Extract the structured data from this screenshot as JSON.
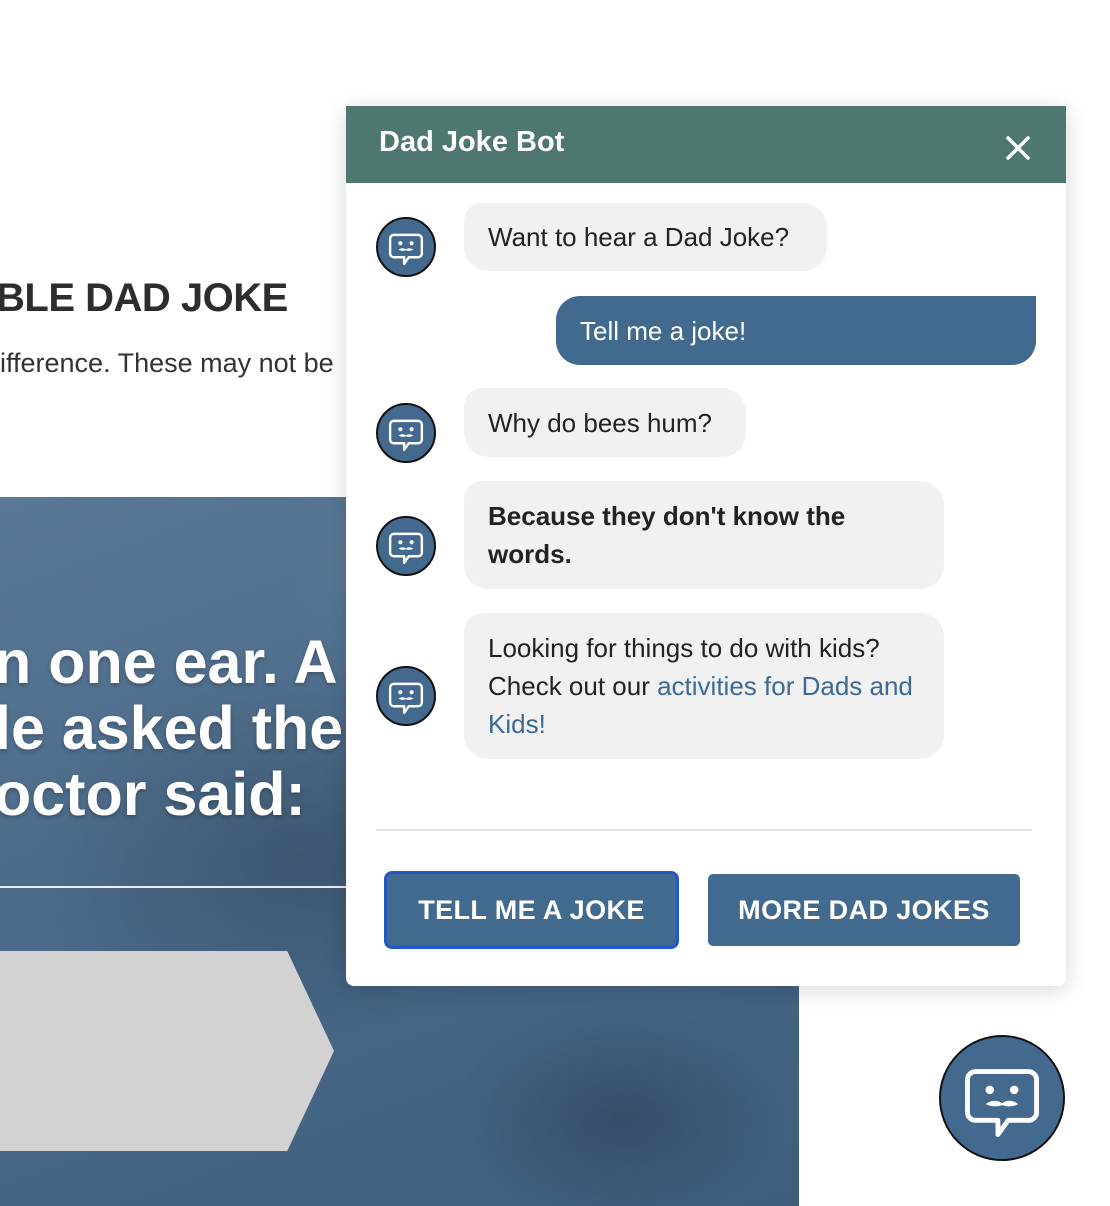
{
  "page": {
    "heading": "BLE DAD JOKE",
    "intro": "ifference. These may not be",
    "hero_lines": [
      "n one ear. A h",
      "le asked the",
      "octor said:"
    ]
  },
  "chat": {
    "title": "Dad Joke Bot",
    "close_label": "Close",
    "messages": [
      {
        "from": "bot",
        "text": "Want to hear a Dad Joke?"
      },
      {
        "from": "user",
        "text": "Tell me a joke!"
      },
      {
        "from": "bot",
        "text": "Why do bees hum?"
      },
      {
        "from": "bot",
        "text": "Because they don't know the words."
      },
      {
        "from": "bot",
        "text": "Looking for things to do with kids? Check out our ",
        "link_text": "activities for Dads and Kids!"
      }
    ],
    "buttons": {
      "tell_joke": "TELL ME A JOKE",
      "more_jokes": "MORE DAD JOKES"
    },
    "launcher_label": "Open Dad Joke Bot"
  },
  "colors": {
    "header": "#4e776f",
    "primary": "#426a8f",
    "bubble_bot": "#f1f1f1",
    "link": "#3c6a95",
    "focus_ring": "#2358c9"
  },
  "icons": {
    "bot_avatar": "chat-bot-mustache-icon",
    "close": "close-icon",
    "launcher": "chat-bot-mustache-icon"
  }
}
